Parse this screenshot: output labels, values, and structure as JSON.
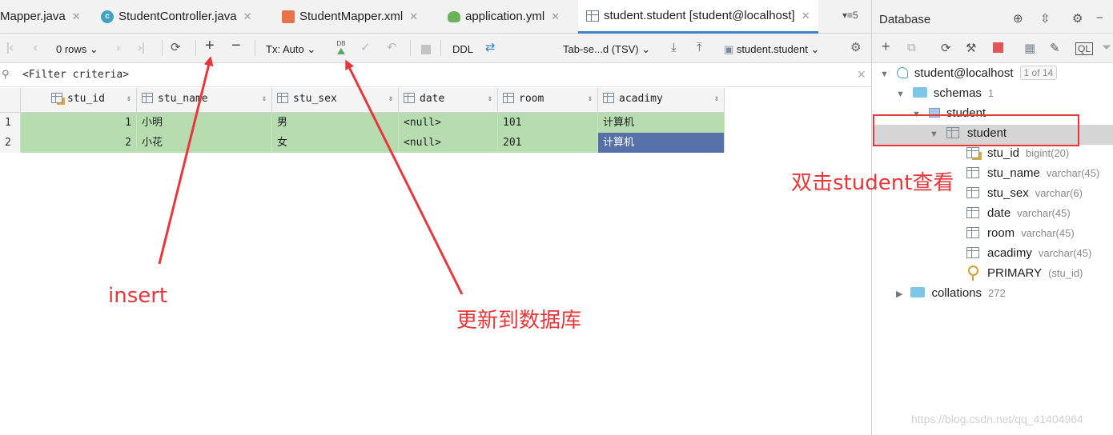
{
  "tabs": [
    {
      "label": "Mapper.java",
      "icon": "none",
      "active": false
    },
    {
      "label": "StudentController.java",
      "icon": "class-icon",
      "active": false
    },
    {
      "label": "StudentMapper.xml",
      "icon": "xml-file-icon",
      "active": false
    },
    {
      "label": "application.yml",
      "icon": "yml-file-icon",
      "active": false
    },
    {
      "label": "student.student [student@localhost]",
      "icon": "table-icon",
      "active": true
    }
  ],
  "tab_overflow_count": "5",
  "close_glyph": "✕",
  "toolbar": {
    "rows_label": "0 rows",
    "tx_label": "Tx: Auto",
    "db_label": "DB",
    "ddl_label": "DDL",
    "format_label": "Tab-se...d (TSV)",
    "table_label": "student.student"
  },
  "filter": {
    "placeholder": "<Filter criteria>"
  },
  "grid": {
    "columns": [
      "stu_id",
      "stu_name",
      "stu_sex",
      "date",
      "room",
      "acadimy"
    ],
    "rows": [
      {
        "num": "1",
        "cells": [
          "1",
          "小明",
          "男",
          "<null>",
          "101",
          "计算机"
        ]
      },
      {
        "num": "2",
        "cells": [
          "2",
          "小花",
          "女",
          "<null>",
          "201",
          "计算机"
        ]
      }
    ]
  },
  "annotations": {
    "insert": "insert",
    "update_db": "更新到数据库",
    "double_click": "双击student查看"
  },
  "annotation_color": "#e8373b",
  "database_panel": {
    "title": "Database",
    "tree": {
      "connection": {
        "label": "student@localhost",
        "badge": "1 of 14"
      },
      "schemas": {
        "label": "schemas",
        "count": "1"
      },
      "schema": {
        "label": "student"
      },
      "table": {
        "label": "student"
      },
      "columns": [
        {
          "name": "stu_id",
          "type": "bigint(20)"
        },
        {
          "name": "stu_name",
          "type": "varchar(45)"
        },
        {
          "name": "stu_sex",
          "type": "varchar(6)"
        },
        {
          "name": "date",
          "type": "varchar(45)"
        },
        {
          "name": "room",
          "type": "varchar(45)"
        },
        {
          "name": "acadimy",
          "type": "varchar(45)"
        }
      ],
      "primary": {
        "label": "PRIMARY",
        "detail": "(stu_id)"
      },
      "collations": {
        "label": "collations",
        "count": "272"
      }
    }
  },
  "watermark": "https://blog.csdn.net/qq_41404964"
}
